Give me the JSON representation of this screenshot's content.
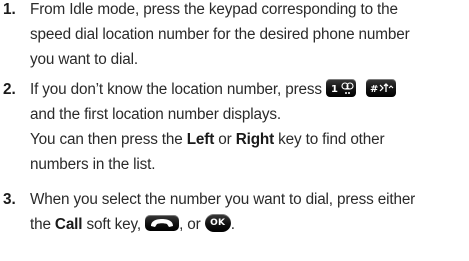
{
  "steps": [
    {
      "number": "1.",
      "lines": [
        "From Idle mode, press the keypad corresponding to the",
        "speed dial location number for the desired phone number",
        "you want to dial."
      ]
    },
    {
      "number": "2.",
      "line1_text": "If you don’t know the location number, press",
      "line2_text": "and the first location number displays.",
      "cont_prefix": "You can then press the ",
      "cont_left": "Left",
      "cont_or": " or ",
      "cont_right": "Right",
      "cont_suffix": " key to find other",
      "cont_line2": "numbers in the list."
    },
    {
      "number": "3.",
      "line1_text": "When you select the number you want to dial, press either",
      "line2_prefix": "the ",
      "line2_call": "Call",
      "line2_mid": " soft key,",
      "line2_or": ", or",
      "line2_end": "."
    }
  ],
  "icons": {
    "key_1": "one-voicemail-key-icon",
    "key_pound": "pound-vibrate-key-icon",
    "key_send": "send-call-key-icon",
    "key_ok": "ok-key-icon",
    "ok_label": "OK"
  }
}
